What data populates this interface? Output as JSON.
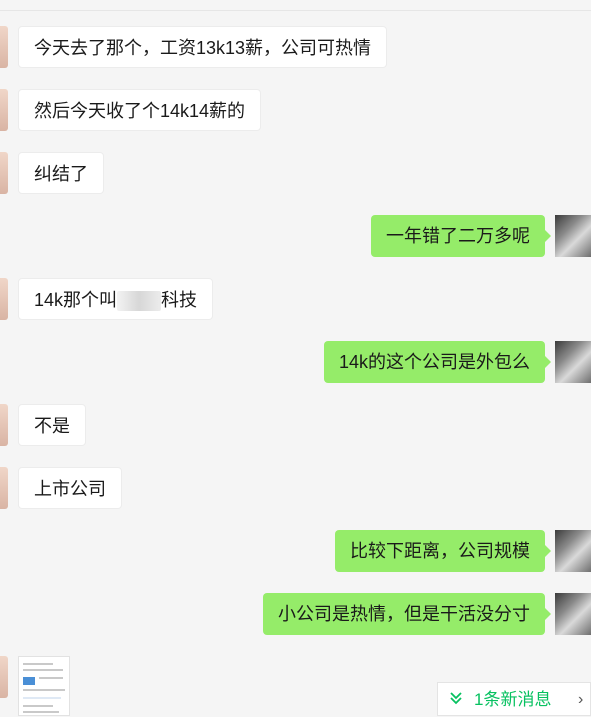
{
  "messages": [
    {
      "side": "left",
      "text": "今天去了那个，工资13k13薪，公司可热情"
    },
    {
      "side": "left",
      "text": "然后今天收了个14k14薪的"
    },
    {
      "side": "left",
      "text": "纠结了"
    },
    {
      "side": "right",
      "text": "一年错了二万多呢"
    },
    {
      "side": "left",
      "text_before": "14k那个叫",
      "text_after": "科技"
    },
    {
      "side": "right",
      "text": "14k的这个公司是外包么"
    },
    {
      "side": "left",
      "text": "不是"
    },
    {
      "side": "left",
      "text": "上市公司"
    },
    {
      "side": "right",
      "text": "比较下距离，公司规模"
    },
    {
      "side": "right",
      "text": "小公司是热情，但是干活没分寸"
    }
  ],
  "new_messages": {
    "label": "1条新消息",
    "chevron_icon": "double-chevron-down-icon",
    "close_icon": "chevron-right-icon",
    "color": "#07c160"
  },
  "colors": {
    "sent_bubble": "#95ec69",
    "received_bubble": "#ffffff",
    "background": "#f5f5f5"
  }
}
